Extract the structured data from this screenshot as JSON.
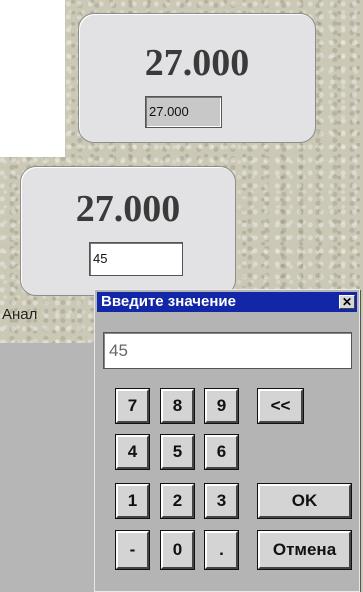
{
  "top_panel": {
    "value": "27.000",
    "field": "27.000"
  },
  "main_panel": {
    "value": "27.000",
    "field": "45"
  },
  "analog_label": "Анал",
  "dialog": {
    "title": "Введите значение",
    "close": "✕",
    "input": "45",
    "keys": {
      "k7": "7",
      "k8": "8",
      "k9": "9",
      "back": "<<",
      "k4": "4",
      "k5": "5",
      "k6": "6",
      "k1": "1",
      "k2": "2",
      "k3": "3",
      "ok": "OK",
      "minus": "-",
      "k0": "0",
      "dot": ".",
      "cancel": "Отмена"
    }
  }
}
